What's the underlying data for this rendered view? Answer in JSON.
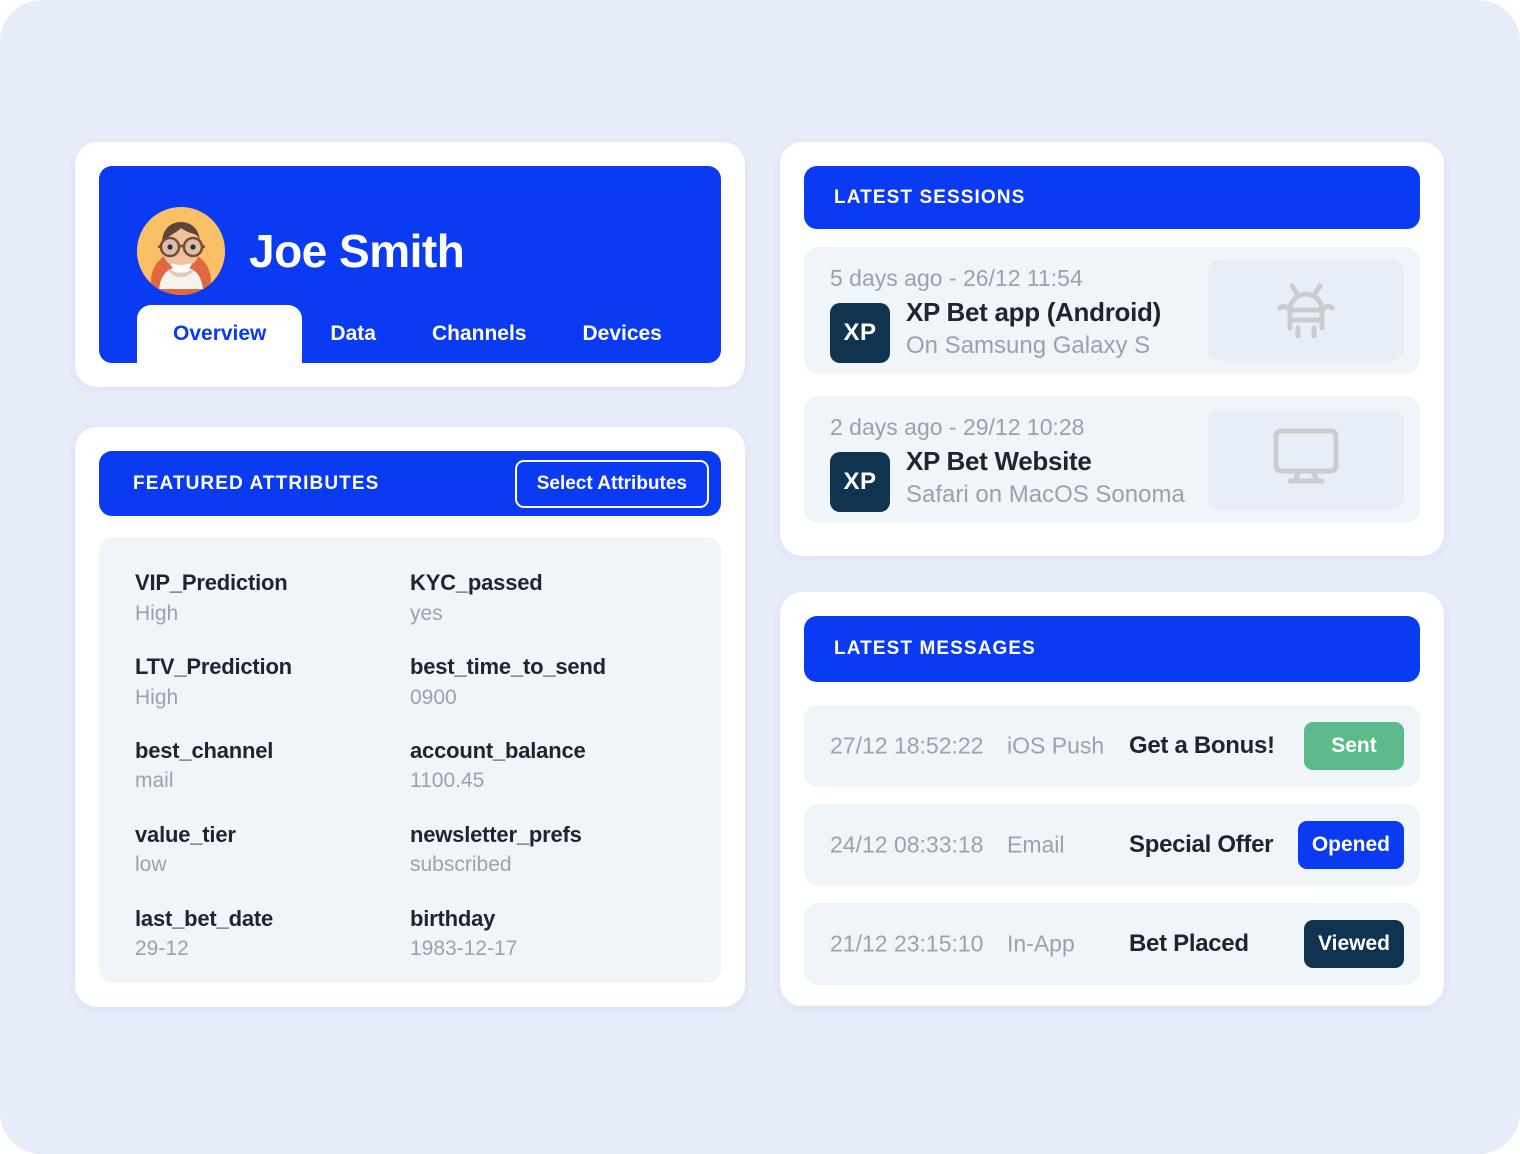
{
  "theme": {
    "page_background": "#e7ecfb",
    "accent_blue": "#0a3bf2",
    "panel_light": "#f0f5fa",
    "navy": "#103450",
    "green": "#5cb98b",
    "muted_text": "#9aa2ad"
  },
  "profile": {
    "name": "Joe Smith",
    "avatar_alt": "user-avatar",
    "tabs": [
      {
        "label": "Overview",
        "active": true
      },
      {
        "label": "Data",
        "active": false
      },
      {
        "label": "Channels",
        "active": false
      },
      {
        "label": "Devices",
        "active": false
      }
    ]
  },
  "attributes_panel": {
    "title": "FEATURED ATTRIBUTES",
    "select_button": "Select Attributes",
    "items": [
      {
        "key": "VIP_Prediction",
        "value": "High"
      },
      {
        "key": "KYC_passed",
        "value": "yes"
      },
      {
        "key": "LTV_Prediction",
        "value": "High"
      },
      {
        "key": "best_time_to_send",
        "value": "0900"
      },
      {
        "key": "best_channel",
        "value": "mail"
      },
      {
        "key": "account_balance",
        "value": "1100.45"
      },
      {
        "key": "value_tier",
        "value": "low"
      },
      {
        "key": "newsletter_prefs",
        "value": "subscribed"
      },
      {
        "key": "last_bet_date",
        "value": "29-12"
      },
      {
        "key": "birthday",
        "value": "1983-12-17"
      }
    ]
  },
  "sessions_panel": {
    "title": "LATEST SESSIONS",
    "rows": [
      {
        "time": "5 days ago - 26/12 11:54",
        "logo": "XP",
        "app": "XP Bet app (Android)",
        "device": "On Samsung Galaxy S",
        "icon": "android-icon"
      },
      {
        "time": "2 days ago - 29/12 10:28",
        "logo": "XP",
        "app": "XP Bet Website",
        "device": "Safari on MacOS Sonoma",
        "icon": "desktop-monitor-icon"
      }
    ]
  },
  "messages_panel": {
    "title": "LATEST MESSAGES",
    "rows": [
      {
        "time": "27/12 18:52:22",
        "channel": "iOS Push",
        "subject": "Get a Bonus!",
        "status": "Sent",
        "status_color": "#5cb98b"
      },
      {
        "time": "24/12 08:33:18",
        "channel": "Email",
        "subject": "Special Offer",
        "status": "Opened",
        "status_color": "#0a3bf2"
      },
      {
        "time": "21/12 23:15:10",
        "channel": "In-App",
        "subject": "Bet Placed",
        "status": "Viewed",
        "status_color": "#103450"
      }
    ]
  }
}
